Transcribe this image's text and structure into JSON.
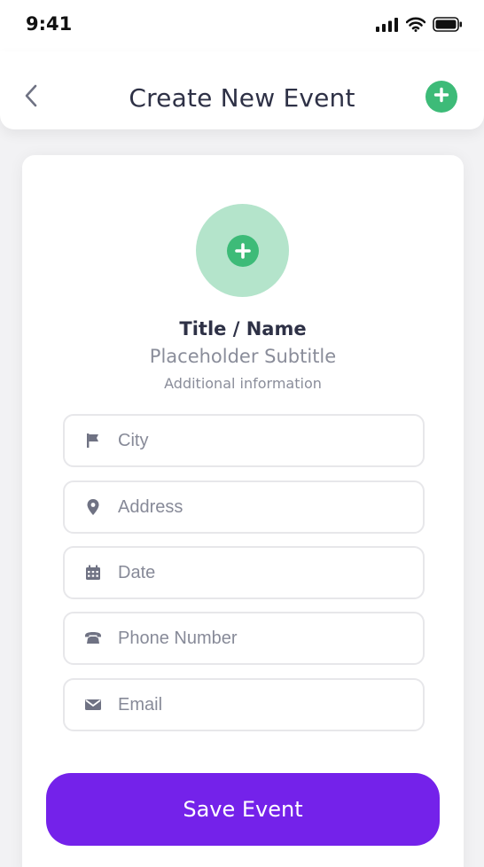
{
  "status_bar": {
    "time": "9:41",
    "icons": [
      "signal-icon",
      "wifi-icon",
      "battery-icon"
    ]
  },
  "header": {
    "title": "Create New Event",
    "back_icon": "chevron-left-icon",
    "add_icon": "plus-circle-icon"
  },
  "profile": {
    "title": "Title / Name",
    "subtitle": "Placeholder Subtitle",
    "info": "Additional information",
    "avatar_icon": "plus-circle-icon"
  },
  "form": {
    "fields": [
      {
        "icon": "flag-icon",
        "placeholder": "City",
        "value": ""
      },
      {
        "icon": "map-pin-icon",
        "placeholder": "Address",
        "value": ""
      },
      {
        "icon": "calendar-icon",
        "placeholder": "Date",
        "value": ""
      },
      {
        "icon": "phone-icon",
        "placeholder": "Phone Number",
        "value": ""
      },
      {
        "icon": "mail-icon",
        "placeholder": "Email",
        "value": ""
      }
    ],
    "submit_label": "Save Event"
  },
  "colors": {
    "accent_green": "#3dbb78",
    "avatar_bg": "#b4e4cb",
    "primary_purple": "#7422ea",
    "text_dark": "#2e3146",
    "text_muted": "#8a8d9a"
  }
}
